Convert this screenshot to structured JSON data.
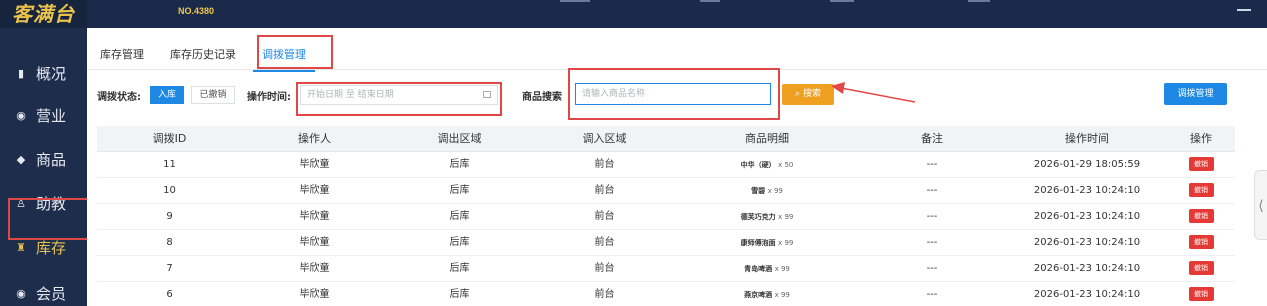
{
  "header": {
    "brand": "客满台",
    "store_no": "NO.4380"
  },
  "sidebar": {
    "items": [
      {
        "icon": "bar-chart-icon",
        "glyph": "▮",
        "label": "概况"
      },
      {
        "icon": "circle-icon",
        "glyph": "◉",
        "label": "营业"
      },
      {
        "icon": "tag-icon",
        "glyph": "◆",
        "label": "商品"
      },
      {
        "icon": "user-icon",
        "glyph": "♙",
        "label": "助教"
      },
      {
        "icon": "warehouse-icon",
        "glyph": "♜",
        "label": "库存"
      },
      {
        "icon": "member-icon",
        "glyph": "◉",
        "label": "会员"
      }
    ],
    "active_index": 4
  },
  "tabs": [
    {
      "label": "库存管理"
    },
    {
      "label": "库存历史记录"
    },
    {
      "label": "调拨管理"
    }
  ],
  "filters": {
    "status_label": "调拨状态:",
    "status_options": [
      "入库",
      "已撤销"
    ],
    "time_label": "操作时间:",
    "date_placeholder": "开始日期 至 结束日期",
    "search_label": "商品搜索",
    "search_placeholder": "请输入商品名称",
    "search_button": "搜索",
    "manage_button": "调拨管理"
  },
  "table": {
    "columns": [
      "调拨ID",
      "操作人",
      "调出区域",
      "调入区域",
      "商品明细",
      "备注",
      "操作时间",
      "操作"
    ],
    "rows": [
      {
        "id": "11",
        "operator": "毕欣童",
        "from": "后库",
        "to": "前台",
        "item": "中华（硬）",
        "qty": "x 50",
        "note": "---",
        "time": "2026-01-29 18:05:59",
        "action": "撤销"
      },
      {
        "id": "10",
        "operator": "毕欣童",
        "from": "后库",
        "to": "前台",
        "item": "雪碧",
        "qty": "x 99",
        "note": "---",
        "time": "2026-01-23 10:24:10",
        "action": "撤销"
      },
      {
        "id": "9",
        "operator": "毕欣童",
        "from": "后库",
        "to": "前台",
        "item": "德芙巧克力",
        "qty": "x 99",
        "note": "---",
        "time": "2026-01-23 10:24:10",
        "action": "撤销"
      },
      {
        "id": "8",
        "operator": "毕欣童",
        "from": "后库",
        "to": "前台",
        "item": "康师傅泡面",
        "qty": "x 99",
        "note": "---",
        "time": "2026-01-23 10:24:10",
        "action": "撤销"
      },
      {
        "id": "7",
        "operator": "毕欣童",
        "from": "后库",
        "to": "前台",
        "item": "青岛啤酒",
        "qty": "x 99",
        "note": "---",
        "time": "2026-01-23 10:24:10",
        "action": "撤销"
      },
      {
        "id": "6",
        "operator": "毕欣童",
        "from": "后库",
        "to": "前台",
        "item": "燕京啤酒",
        "qty": "x 99",
        "note": "---",
        "time": "2026-01-23 10:24:10",
        "action": "撤销"
      }
    ]
  },
  "colors": {
    "primary": "#1e88e5",
    "warning": "#f0a020",
    "danger": "#e53935",
    "annotation_red": "#e04747",
    "sidebar_bg": "#1f2d4c",
    "brand_gold": "#e8c24a"
  }
}
